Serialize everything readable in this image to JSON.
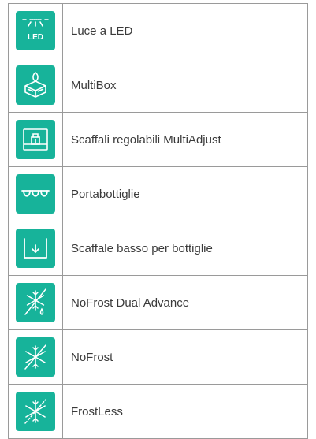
{
  "colors": {
    "icon_bg": "#17b39a",
    "border": "#9a9a9a",
    "text": "#3a3a3a"
  },
  "features": [
    {
      "icon": "led-light-icon",
      "icon_text": "LED",
      "label": "Luce a LED"
    },
    {
      "icon": "multibox-icon",
      "label": "MultiBox"
    },
    {
      "icon": "adjustable-shelves-icon",
      "label": "Scaffali regolabili MultiAdjust"
    },
    {
      "icon": "bottle-rack-icon",
      "label": "Portabottiglie"
    },
    {
      "icon": "low-bottle-shelf-icon",
      "label": "Scaffale basso per bottiglie"
    },
    {
      "icon": "nofrost-dual-advance-icon",
      "label": "NoFrost Dual Advance"
    },
    {
      "icon": "nofrost-icon",
      "label": "NoFrost"
    },
    {
      "icon": "frostless-icon",
      "label": "FrostLess"
    }
  ]
}
